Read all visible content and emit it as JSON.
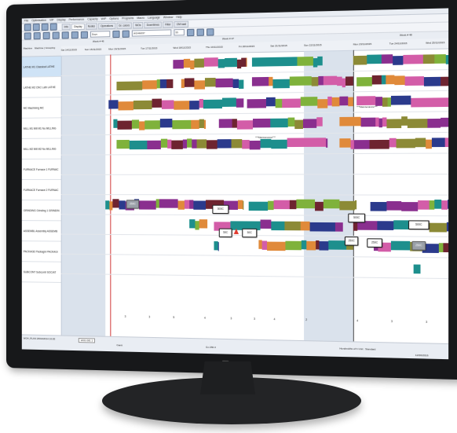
{
  "menu": [
    "File",
    "Optimisation",
    "VIP",
    "Display",
    "Performance",
    "Capacity",
    "WIP",
    "Options",
    "Programs",
    "Macro",
    "Language",
    "Window",
    "Help"
  ],
  "tabs": [
    "Info",
    "Display",
    "Nodes",
    "Operations",
    "Gr. colors",
    "WOs",
    "Downtimes",
    "Filter",
    "CM load"
  ],
  "toolbar": {
    "combo_view": "Days",
    "combo_order": "WO4M037",
    "combo_small": "55"
  },
  "left_header": [
    "Machine",
    "Machine | Grouping"
  ],
  "machines": [
    "LATHE M1  Classical  LATHE",
    "LATHE M2  CNC Lath  LATHE",
    "MC        Machining  MC",
    "MILL M1   Mill M1 Nu  MILLING",
    "MILL M2   Mill M2 Nu  MILLING",
    "FURNACE  Furnace 1  FURNAC",
    "FURNACE  Furnace 2  FURNAC",
    "GRINDING  Grinding 1  GRINDIN",
    "ASSEMBL  Assembly  ASSEMB",
    "PACKAGE  Packagin  PACKAGI",
    "SUBCONT  Subcontr  SOCIAT"
  ],
  "weeks": [
    "Week # 46",
    "Week # 47",
    "Week # 48"
  ],
  "days": [
    "Sat 14/11/2015",
    "Sun 15/11/2015",
    "Mon 16/11/2015",
    "Tue 17/11/2015",
    "Wed 18/11/2015",
    "Thu 19/11/2015",
    "Fri 20/11/2015",
    "Sat 21/11/2015",
    "Sun 22/11/2015",
    "Mon 23/11/2015",
    "Tue 24/11/2015",
    "Wed 25/11/2015"
  ],
  "tags": {
    "f1_a": "250C",
    "f1_b": "500C",
    "f2_a": "500C",
    "f2_b": "500C",
    "g_a": "50C",
    "g_b": "50C",
    "g_c": "250C",
    "g_d": "250C",
    "g_e": "250C",
    "maint_a": "***Maintenance***",
    "maint_b": "***Maintenance***"
  },
  "counts": [
    "3",
    "3",
    "5",
    "4",
    "3",
    "3",
    "4",
    "2",
    "4",
    "3",
    "3"
  ],
  "status": {
    "sheet": "WO1 001 1",
    "left": "Gantt",
    "mid": "Gx  256.3",
    "right": "Hundredths of h  Unit : Standard",
    "date": "12/06/2016",
    "path": "WO4_PLAN 28/10/2014 16:05",
    "bottom_tab": "NGT20901"
  },
  "colors": {
    "purple": "#8a2f8f",
    "teal": "#1d8f8d",
    "green": "#7fb23b",
    "pink": "#d35da8",
    "orange": "#e08a3a",
    "navy": "#2b3a8c",
    "olive": "#8c8a36",
    "maroon": "#6e2430",
    "weekend": "#cdd8e5"
  }
}
